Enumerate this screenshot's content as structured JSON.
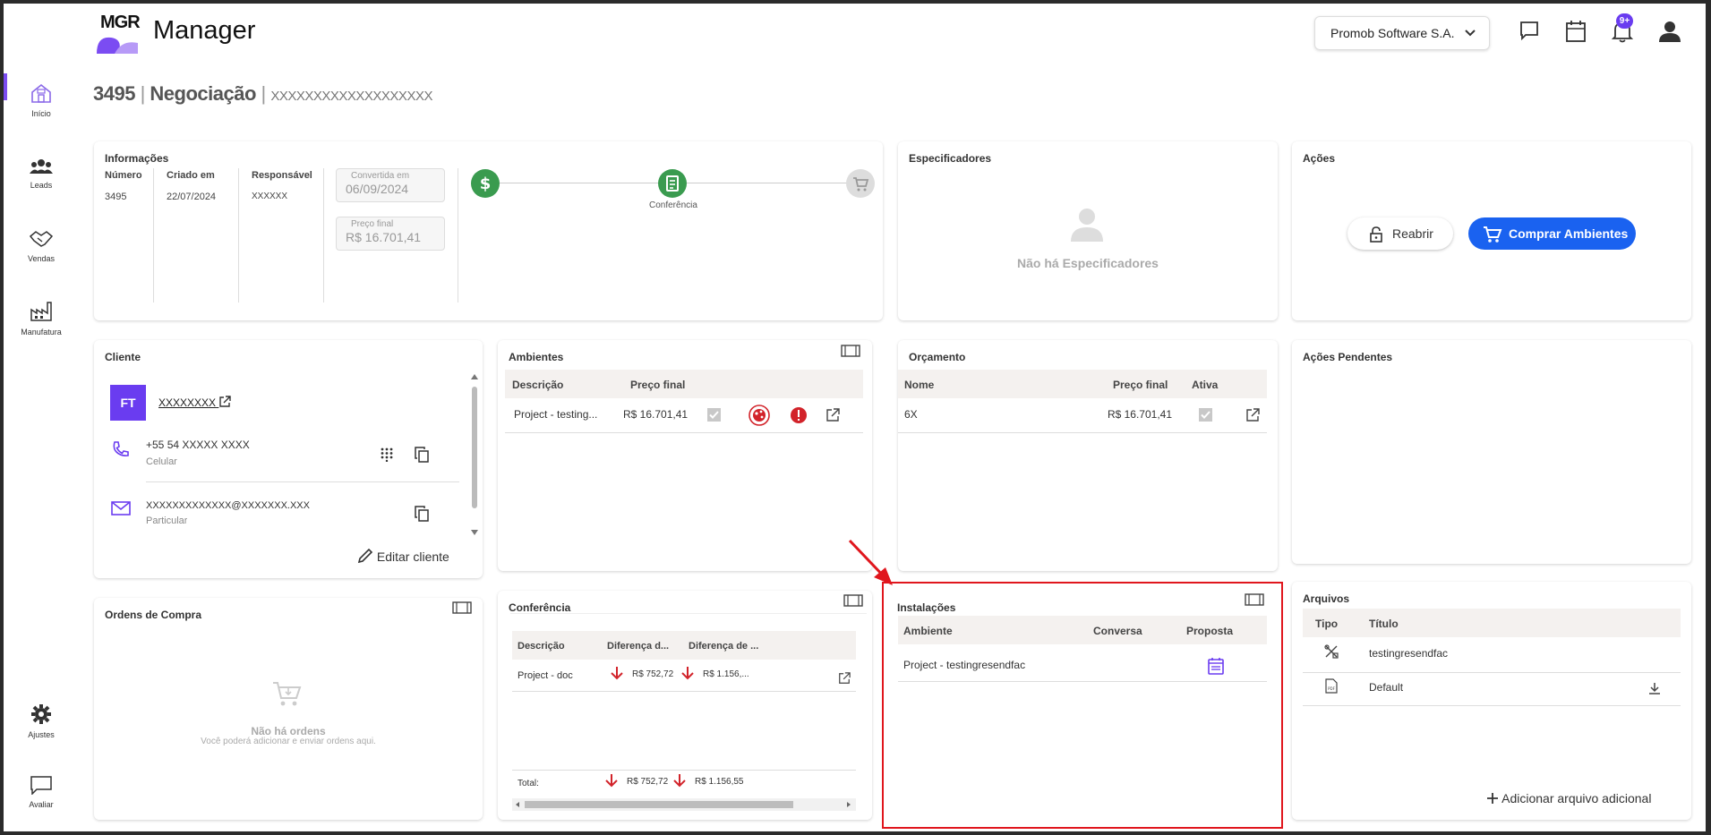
{
  "app": {
    "logo_text": "MGR",
    "title": "Manager"
  },
  "sidebar": {
    "items": [
      {
        "label": "Início",
        "icon": "home-icon"
      },
      {
        "label": "Leads",
        "icon": "people-icon"
      },
      {
        "label": "Vendas",
        "icon": "handshake-icon"
      },
      {
        "label": "Manufatura",
        "icon": "factory-icon"
      },
      {
        "label": "Ajustes",
        "icon": "gear-icon"
      },
      {
        "label": "Avaliar",
        "icon": "feedback-icon"
      }
    ]
  },
  "header": {
    "company": "Promob Software S.A.",
    "notifications_badge": "9+"
  },
  "breadcrumb": {
    "id": "3495",
    "stage": "Negociação",
    "name": "XXXXXXXXXXXXXXXXXXX"
  },
  "informacoes": {
    "title": "Informações",
    "numero_label": "Número",
    "numero": "3495",
    "criado_label": "Criado em",
    "criado": "22/07/2024",
    "responsavel_label": "Responsável",
    "responsavel": "XXXXXX",
    "convertida_label": "Convertida em",
    "convertida": "06/09/2024",
    "preco_label": "Preço final",
    "preco": "R$ 16.701,41",
    "step_label": "Conferência"
  },
  "especificadores": {
    "title": "Especificadores",
    "empty": "Não há Especificadores"
  },
  "acoes": {
    "title": "Ações",
    "reabrir": "Reabrir",
    "comprar": "Comprar Ambientes"
  },
  "cliente": {
    "title": "Cliente",
    "initials": "FT",
    "name": "XXXXXXXX",
    "phone": "+55 54 XXXXX XXXX",
    "phone_type": "Celular",
    "email": "XXXXXXXXXXXXX@XXXXXXX.XXX",
    "email_type": "Particular",
    "edit": "Editar cliente"
  },
  "ambientes": {
    "title": "Ambientes",
    "col_desc": "Descrição",
    "col_preco": "Preço final",
    "rows": [
      {
        "desc": "Project - testing...",
        "preco": "R$ 16.701,41"
      }
    ]
  },
  "orcamento": {
    "title": "Orçamento",
    "col_nome": "Nome",
    "col_preco": "Preço final",
    "col_ativa": "Ativa",
    "rows": [
      {
        "nome": "6X",
        "preco": "R$ 16.701,41"
      }
    ]
  },
  "acoes_pendentes": {
    "title": "Ações Pendentes"
  },
  "ordens": {
    "title": "Ordens de Compra",
    "empty": "Não há ordens",
    "empty_sub": "Você poderá adicionar e enviar ordens aqui."
  },
  "conferencia": {
    "title": "Conferência",
    "col_desc": "Descrição",
    "col_dif1": "Diferença d...",
    "col_dif2": "Diferença de ...",
    "rows": [
      {
        "desc": "Project - doc",
        "dif1": "R$ 752,72",
        "dif2": "R$ 1.156,..."
      }
    ],
    "total_label": "Total:",
    "total1": "R$ 752,72",
    "total2": "R$ 1.156,55"
  },
  "instalacoes": {
    "title": "Instalações",
    "col_ambiente": "Ambiente",
    "col_conversa": "Conversa",
    "col_proposta": "Proposta",
    "rows": [
      {
        "ambiente": "Project - testingresendfac"
      }
    ]
  },
  "arquivos": {
    "title": "Arquivos",
    "col_tipo": "Tipo",
    "col_titulo": "Título",
    "rows": [
      {
        "titulo": "testingresendfac"
      },
      {
        "titulo": "Default"
      }
    ],
    "add": "Adicionar arquivo adicional"
  },
  "colors": {
    "accent": "#7b4cf2",
    "primary": "#1a62f0",
    "success": "#3a9b4f",
    "danger": "#e0161d"
  }
}
